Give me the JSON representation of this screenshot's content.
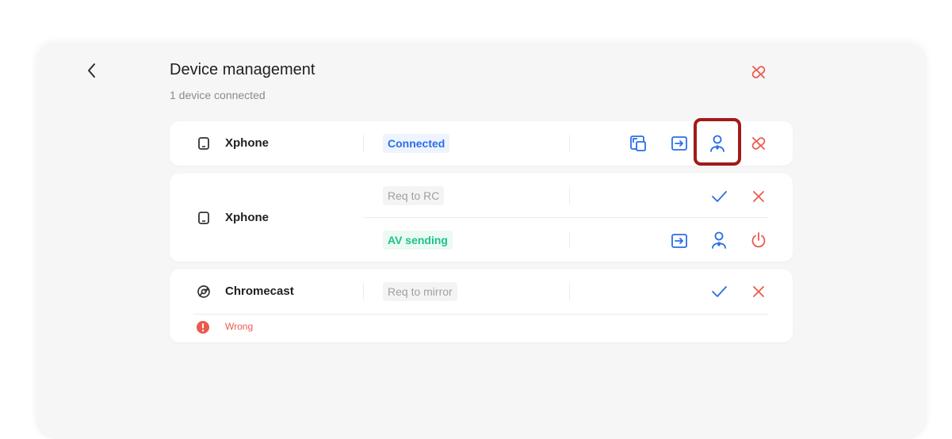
{
  "header": {
    "title": "Device management",
    "subtitle": "1 device connected",
    "back_icon": "chevron-left-icon",
    "action_icon": "unlink-icon"
  },
  "devices": [
    {
      "name": "Xphone",
      "icon": "phone-icon",
      "rows": [
        {
          "status": "Connected",
          "status_style": "blue",
          "actions": [
            "screen-share-icon",
            "cast-in-icon",
            "remote-control-icon",
            "unlink-icon"
          ],
          "highlighted_action": "remote-control-icon"
        }
      ]
    },
    {
      "name": "Xphone",
      "icon": "phone-icon",
      "rows": [
        {
          "status": "Req to RC",
          "status_style": "gray",
          "actions": [
            "check-icon",
            "close-icon"
          ]
        },
        {
          "status": "AV sending",
          "status_style": "green",
          "actions": [
            "cast-in-icon",
            "remote-control-icon",
            "power-icon"
          ]
        }
      ]
    },
    {
      "name": "Chromecast",
      "icon": "chromecast-icon",
      "rows": [
        {
          "status": "Req to mirror",
          "status_style": "gray",
          "actions": [
            "check-icon",
            "close-icon"
          ]
        }
      ],
      "error": {
        "icon": "error-icon",
        "text": "Wrong"
      }
    }
  ],
  "colors": {
    "accent": "#2a6ee8",
    "danger": "#ea5a4e",
    "success": "#1fc189",
    "highlight": "#a11a1a"
  }
}
